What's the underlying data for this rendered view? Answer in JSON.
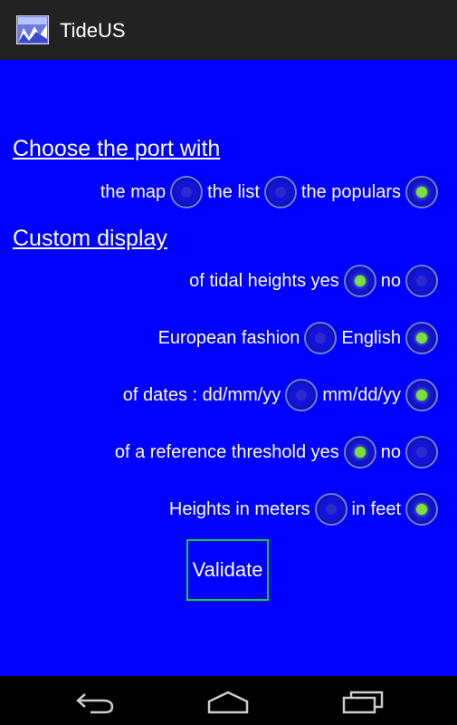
{
  "app": {
    "title": "TideUS",
    "icon": "app-tide-icon"
  },
  "port_section": {
    "heading": "Choose the port with",
    "options": [
      {
        "label": "the map",
        "checked": false
      },
      {
        "label": "the list",
        "checked": false
      },
      {
        "label": "the populars",
        "checked": true
      }
    ]
  },
  "custom_section": {
    "heading": "Custom display",
    "tidal_heights": {
      "label": "of tidal heights yes",
      "yes_checked": true,
      "no_label": "no",
      "no_checked": false
    },
    "fashion": {
      "label": "European fashion",
      "european_checked": false,
      "english_label": "English",
      "english_checked": true
    },
    "dates": {
      "label": "of dates : dd/mm/yy",
      "ddmmyy_checked": false,
      "mmddyy_label": "mm/dd/yy",
      "mmddyy_checked": true
    },
    "threshold": {
      "label": "of a reference threshold yes",
      "yes_checked": true,
      "no_label": "no",
      "no_checked": false
    },
    "units": {
      "label": "Heights in meters",
      "meters_checked": false,
      "feet_label": "in feet",
      "feet_checked": true
    }
  },
  "validate_label": "Validate",
  "colors": {
    "background": "#0000ff",
    "actionbar": "#222222",
    "radio_checked": "#7be03b",
    "validate_border": "#18d02a"
  },
  "navbar": {
    "back": "back-icon",
    "home": "home-icon",
    "recents": "recents-icon"
  }
}
